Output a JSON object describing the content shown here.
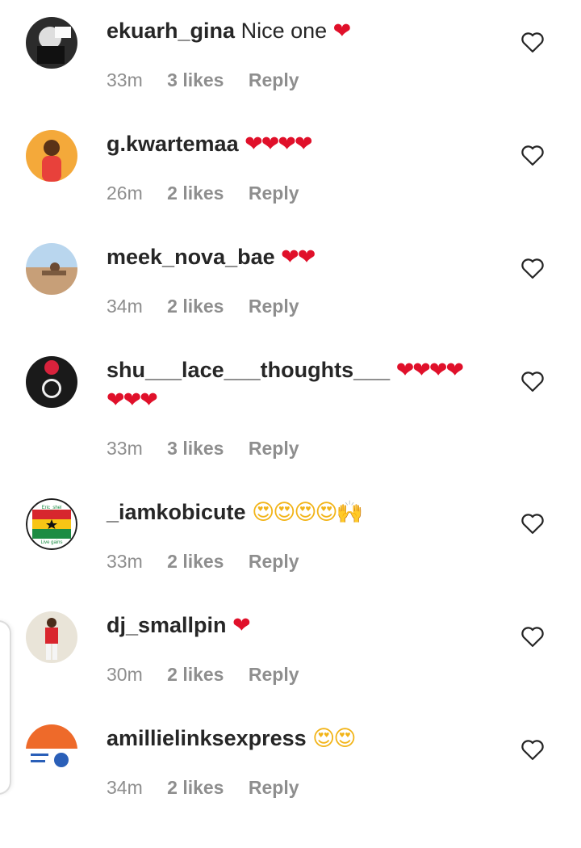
{
  "comments": [
    {
      "username": "ekuarh_gina",
      "text": "Nice one",
      "emoji": "❤",
      "emoji_kind": "heart",
      "time": "33m",
      "likes": "3 likes",
      "reply": "Reply",
      "avatar_icon": "avatar-photo-icon"
    },
    {
      "username": "g.kwartemaa",
      "text": "",
      "emoji": "❤❤❤❤",
      "emoji_kind": "heart",
      "time": "26m",
      "likes": "2 likes",
      "reply": "Reply",
      "avatar_icon": "avatar-photo-icon"
    },
    {
      "username": "meek_nova_bae",
      "text": "",
      "emoji": "❤❤",
      "emoji_kind": "heart",
      "time": "34m",
      "likes": "2 likes",
      "reply": "Reply",
      "avatar_icon": "avatar-photo-icon"
    },
    {
      "username": "shu___lace___thoughts___",
      "text": "",
      "emoji": "❤❤❤❤",
      "emoji_line2": "❤❤❤",
      "emoji_kind": "heart",
      "time": "33m",
      "likes": "3 likes",
      "reply": "Reply",
      "avatar_icon": "avatar-photo-icon"
    },
    {
      "username": "_iamkobicute",
      "text": "",
      "emoji": "😍😍😍😍🙌",
      "emoji_kind": "face",
      "time": "33m",
      "likes": "2 likes",
      "reply": "Reply",
      "avatar_icon": "avatar-flag-icon",
      "avatar_text_top": "Eric_shel",
      "avatar_text_bottom": "Live gains"
    },
    {
      "username": "dj_smallpin",
      "text": "",
      "emoji": "❤",
      "emoji_kind": "heart",
      "time": "30m",
      "likes": "2 likes",
      "reply": "Reply",
      "avatar_icon": "avatar-photo-icon"
    },
    {
      "username": "amillielinksexpress",
      "text": "",
      "emoji": "😍😍",
      "emoji_kind": "face",
      "time": "34m",
      "likes": "2 likes",
      "reply": "Reply",
      "avatar_icon": "avatar-delivery-icon"
    }
  ],
  "like_icon": "heart-outline-icon",
  "colors": {
    "text": "#262626",
    "meta": "#8e8e8e",
    "heart": "#e0102a"
  }
}
